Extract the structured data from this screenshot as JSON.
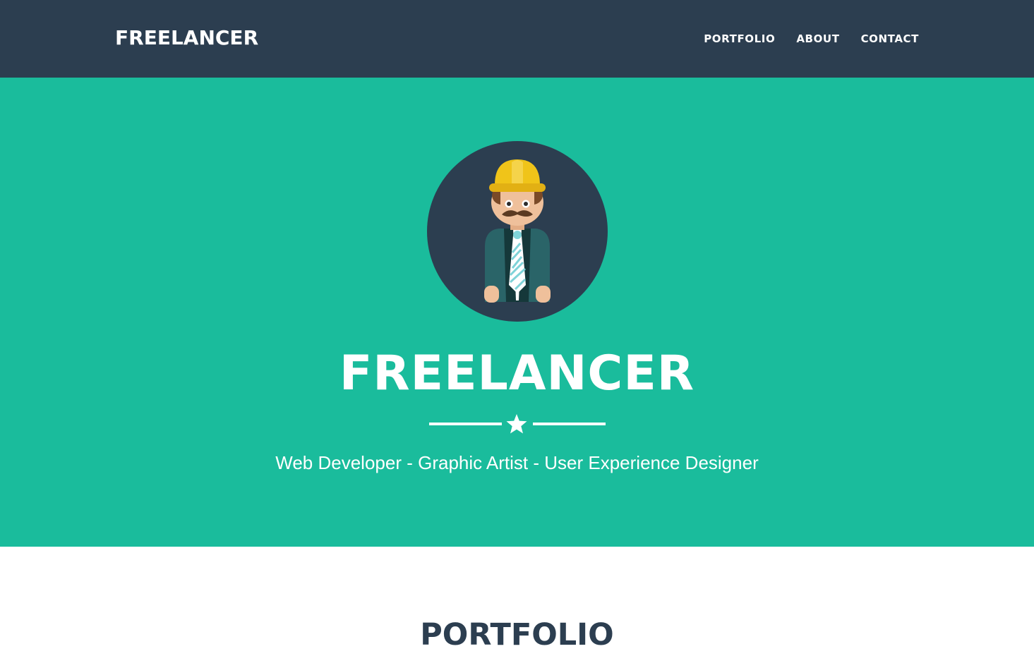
{
  "navbar": {
    "brand": "FREELANCER",
    "links": [
      {
        "label": "PORTFOLIO"
      },
      {
        "label": "ABOUT"
      },
      {
        "label": "CONTACT"
      }
    ]
  },
  "hero": {
    "avatar_icon": "freelancer-avatar-icon",
    "title": "FREELANCER",
    "divider_icon": "star-icon",
    "subtitle": "Web Developer - Graphic Artist - User Experience Designer"
  },
  "portfolio": {
    "heading": "PORTFOLIO"
  },
  "colors": {
    "navbar_bg": "#2c3e50",
    "hero_bg": "#1abc9c",
    "text_light": "#ffffff",
    "heading_dark": "#2c3e50"
  }
}
